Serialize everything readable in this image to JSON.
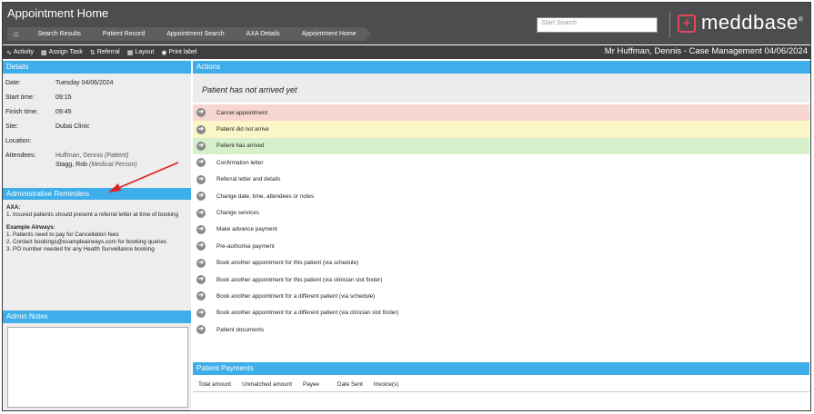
{
  "header": {
    "title": "Appointment Home",
    "breadcrumbs": [
      "Search Results",
      "Patient Record",
      "Appointment Search",
      "AXA Details",
      "Appointment Home"
    ],
    "search_placeholder": "Start Search",
    "logo_text": "meddbase",
    "logo_mark": "®"
  },
  "toolbar": {
    "activity": "Activity",
    "assign_task": "Assign Task",
    "referral": "Referral",
    "layout": "Layout",
    "print_label": "Print label",
    "context_title": "Mr Huffman, Dennis - Case Management 04/06/2024"
  },
  "details": {
    "heading": "Details",
    "rows": [
      {
        "label": "Date:",
        "value": "Tuesday 04/06/2024"
      },
      {
        "label": "Start time:",
        "value": "09:15"
      },
      {
        "label": "Finish time:",
        "value": "09:45"
      },
      {
        "label": "Site:",
        "value": "Dubai Clinic"
      },
      {
        "label": "Location:",
        "value": ""
      }
    ],
    "attendees_label": "Attendees:",
    "attendee1_name": "Huffman, Dennis",
    "attendee1_role": "(Patient)",
    "attendee2_name": "Stagg, Rob",
    "attendee2_role": "(Medical Person)"
  },
  "reminders": {
    "heading": "Administrative Reminders",
    "axa_title": "AXA:",
    "axa_line1": "1. Insured patients should present a referral letter at time of booking",
    "airways_title": "Example Airways:",
    "airways_line1": "1. Patients need to pay for Cancellation fees",
    "airways_line2": "2. Contact bookings@exampleairways.com for booking queries",
    "airways_line3": "3. PO number needed for any Health Surveillance booking"
  },
  "admin_notes": {
    "heading": "Admin Notes"
  },
  "actions": {
    "heading": "Actions",
    "status": "Patient has not arrived yet",
    "items": [
      {
        "label": "Cancel appointment",
        "bg": "#f7d6d2"
      },
      {
        "label": "Patient did not arrive",
        "bg": "#fbf6c8"
      },
      {
        "label": "Patient has arrived",
        "bg": "#d6f0cc"
      },
      {
        "label": "Confirmation letter",
        "bg": "#ffffff"
      },
      {
        "label": "Referral letter and details",
        "bg": "#ffffff"
      },
      {
        "label": "Change date, time, attendees or notes",
        "bg": "#ffffff"
      },
      {
        "label": "Change services",
        "bg": "#ffffff"
      },
      {
        "label": "Make advance payment",
        "bg": "#ffffff"
      },
      {
        "label": "Pre-authorise payment",
        "bg": "#ffffff"
      },
      {
        "label": "Book another appointment for this patient (via schedule)",
        "bg": "#ffffff"
      },
      {
        "label": "Book another appointment for this patient (via clinician slot finder)",
        "bg": "#ffffff"
      },
      {
        "label": "Book another appointment for a different patient (via schedule)",
        "bg": "#ffffff"
      },
      {
        "label": "Book another appointment for a different patient (via clinician slot finder)",
        "bg": "#ffffff"
      },
      {
        "label": "Patient documents",
        "bg": "#ffffff"
      }
    ]
  },
  "payments": {
    "heading": "Patient Payments",
    "columns": [
      "Total amount",
      "Unmatched amount",
      "Payee",
      "Date Sent",
      "Invoice(s)"
    ]
  },
  "colors": {
    "accent": "#3daee9",
    "header_bg": "#4d4d4f",
    "brand": "#e0485a",
    "arrow": "#e02020"
  }
}
